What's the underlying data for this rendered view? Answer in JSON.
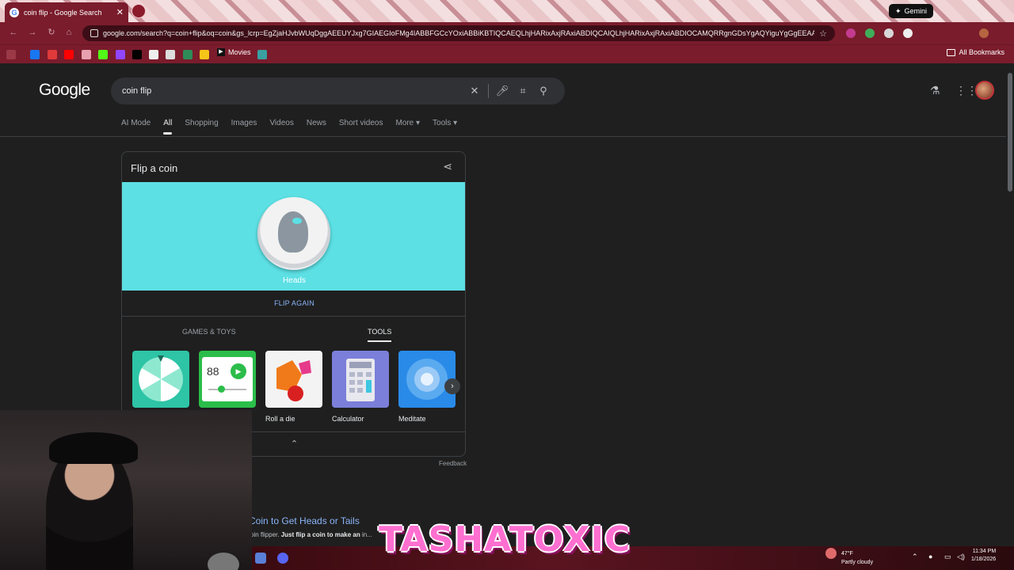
{
  "browser": {
    "tab_title": "coin flip - Google Search",
    "gemini_label": "Gemini",
    "url": "google.com/search?q=coin+flip&oq=coin&gs_lcrp=EgZjaHJvbWUqDggAEEUYJxg7GIAEGIoFMg4IABBFGCcYOxiABBiKBTIQCAEQLhjHARixAxjRAxiABDIQCAIQLhjHARixAxjRAxiABDIOCAMQRRgnGDsYgAQYiguYgGgEEAA...",
    "bookmark_movies": "Movies",
    "all_bookmarks": "All Bookmarks"
  },
  "google": {
    "logo": "Google",
    "query": "coin flip",
    "tabs": [
      "AI Mode",
      "All",
      "Shopping",
      "Images",
      "Videos",
      "News",
      "Short videos",
      "More ▾",
      "Tools ▾"
    ],
    "active_tab": "All"
  },
  "coin_card": {
    "title": "Flip a coin",
    "result": "Heads",
    "flip_again": "FLIP AGAIN",
    "subtab_games": "GAMES & TOYS",
    "subtab_tools": "TOOLS",
    "tools": [
      {
        "label": "",
        "color": "#2ec4a6"
      },
      {
        "label": "",
        "color": "#2bbd4a"
      },
      {
        "label": "Roll a die",
        "color": "#f3f3f3"
      },
      {
        "label": "Calculator",
        "color": "#7b7fd9"
      },
      {
        "label": "Meditate",
        "color": "#2a8ae8"
      }
    ],
    "metronome_value": "88",
    "feedback": "Feedback"
  },
  "result": {
    "title": "Coin to Get Heads or Tails",
    "snippet_prefix": "oin flipper. ",
    "snippet_bold": "Just flip a coin to make an ",
    "snippet_tail": "in..."
  },
  "taskbar": {
    "temperature": "47°F",
    "weather": "Partly cloudy",
    "time": "11:34 PM",
    "date": "1/18/2026"
  },
  "overlay": {
    "brand": "TASHATOXIC"
  },
  "colors": {
    "accent_link": "#8ab4f8",
    "coin_bg": "#5ce0e4",
    "chrome": "#7a1c2c",
    "brand": "#ff6fd0"
  }
}
